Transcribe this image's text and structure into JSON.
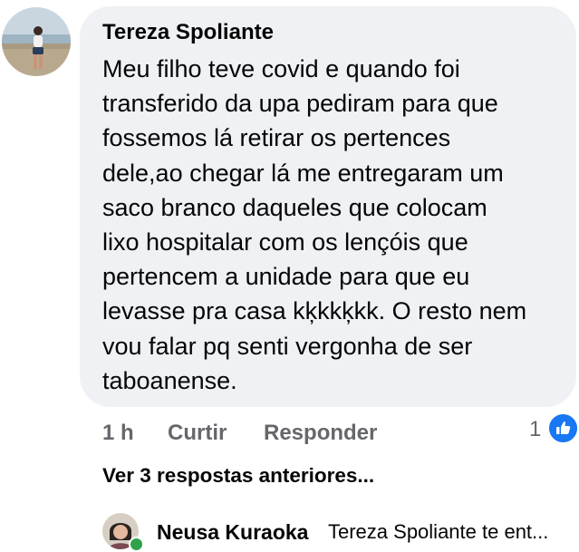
{
  "comment": {
    "author": "Tereza Spoliante",
    "text_lines": [
      "Meu filho teve covid e quando foi",
      "transferido da upa pediram para que",
      "fossemos lá retirar os pertences",
      "dele,ao chegar lá me entregaram um",
      "saco branco daqueles que colocam",
      "lixo hospitalar com os lençóis que",
      "pertencem a unidade para que eu",
      "levasse pra casa kķkkķkk. O resto nem",
      "vou falar pq senti vergonha de ser",
      "taboanense."
    ],
    "time": "1 h",
    "like_label": "Curtir",
    "reply_label": "Responder",
    "reaction_count": "1",
    "reaction_icon": "thumbs-up-icon",
    "reaction_color": "#1877f2"
  },
  "replies": {
    "view_previous_label": "Ver 3 respostas anteriores...",
    "latest": {
      "author": "Neusa Kuraoka",
      "preview": "Tereza Spoliante te ent...",
      "online_color": "#31a24c"
    }
  }
}
